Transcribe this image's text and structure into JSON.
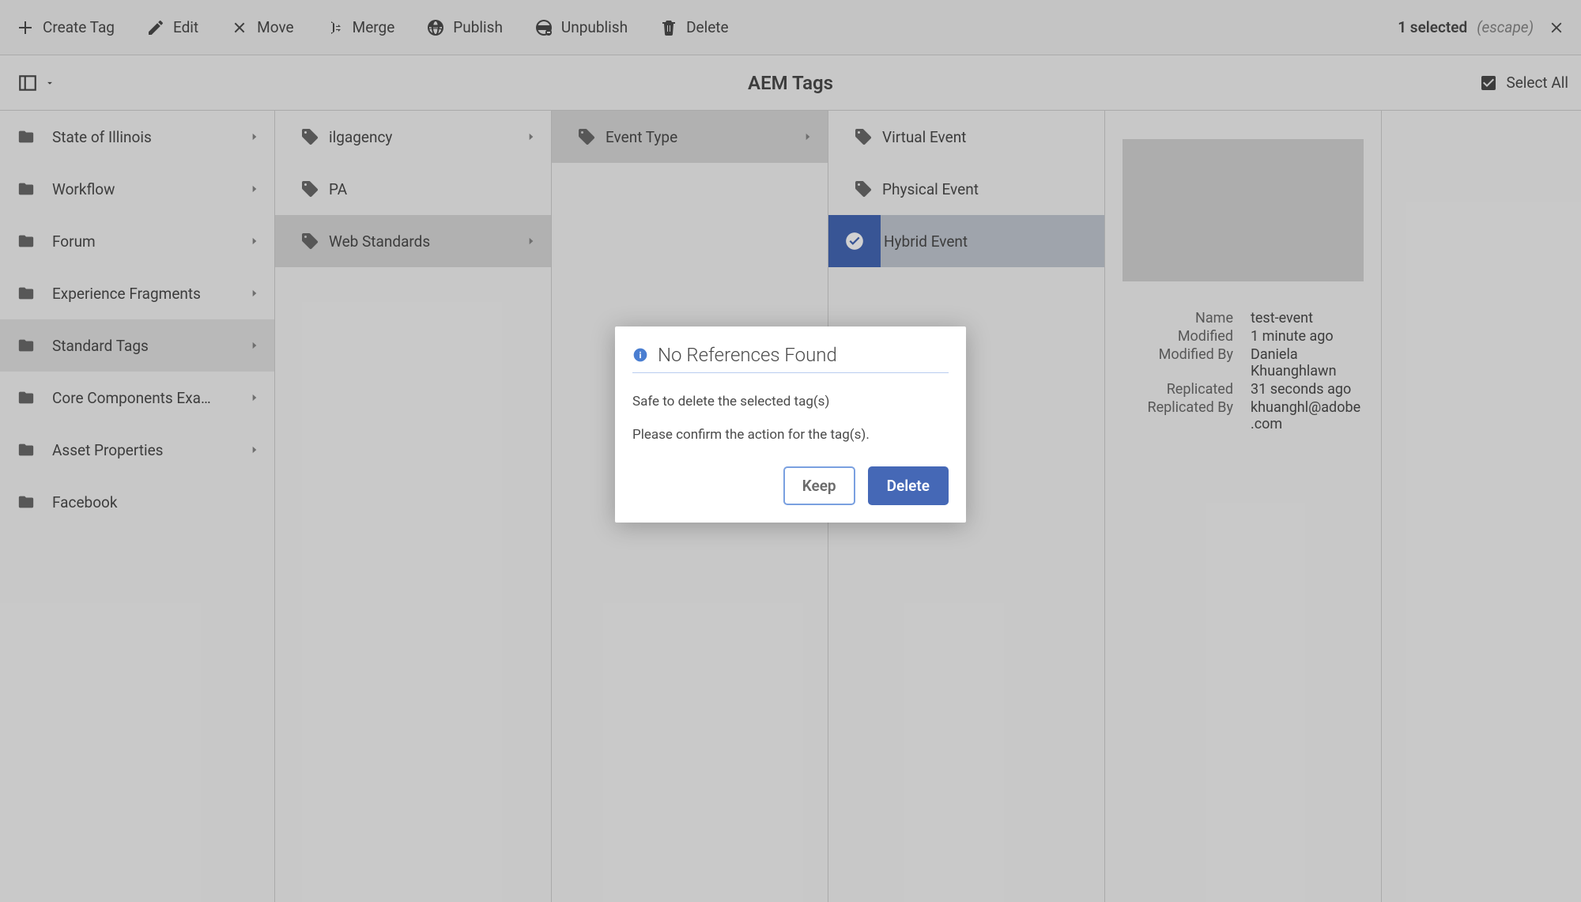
{
  "toolbar": {
    "create": "Create Tag",
    "edit": "Edit",
    "move": "Move",
    "merge": "Merge",
    "publish": "Publish",
    "unpublish": "Unpublish",
    "delete": "Delete",
    "selected": "1 selected",
    "escape": "(escape)"
  },
  "header": {
    "title": "AEM Tags",
    "select_all": "Select All"
  },
  "columns": {
    "c1": [
      {
        "label": "State of Illinois",
        "chev": true
      },
      {
        "label": "Workflow",
        "chev": true
      },
      {
        "label": "Forum",
        "chev": true
      },
      {
        "label": "Experience Fragments",
        "chev": true
      },
      {
        "label": "Standard Tags",
        "chev": true,
        "sel": true
      },
      {
        "label": "Core Components Exa…",
        "chev": true
      },
      {
        "label": "Asset Properties",
        "chev": true
      },
      {
        "label": "Facebook",
        "chev": false
      }
    ],
    "c2": [
      {
        "label": "ilgagency",
        "chev": true
      },
      {
        "label": "PA",
        "chev": false
      },
      {
        "label": "Web Standards",
        "chev": true,
        "sel": true
      }
    ],
    "c3": [
      {
        "label": "Event Type",
        "chev": true,
        "sel": true
      }
    ],
    "c4": [
      {
        "label": "Virtual Event",
        "chev": false
      },
      {
        "label": "Physical Event",
        "chev": false
      },
      {
        "label": "Hybrid Event",
        "chev": false,
        "selected": true
      }
    ]
  },
  "details": {
    "keys": {
      "name": "Name",
      "modified": "Modified",
      "modified_by": "Modified By",
      "replicated": "Replicated",
      "replicated_by": "Replicated By"
    },
    "vals": {
      "name": "test-event",
      "modified": "1 minute ago",
      "modified_by": "Daniela Khuanghlawn",
      "replicated": "31 seconds ago",
      "replicated_by": "khuanghl@adobe.com"
    }
  },
  "dialog": {
    "title": "No References Found",
    "line1": "Safe to delete the selected tag(s)",
    "line2": "Please confirm the action for the tag(s).",
    "keep": "Keep",
    "delete": "Delete"
  }
}
